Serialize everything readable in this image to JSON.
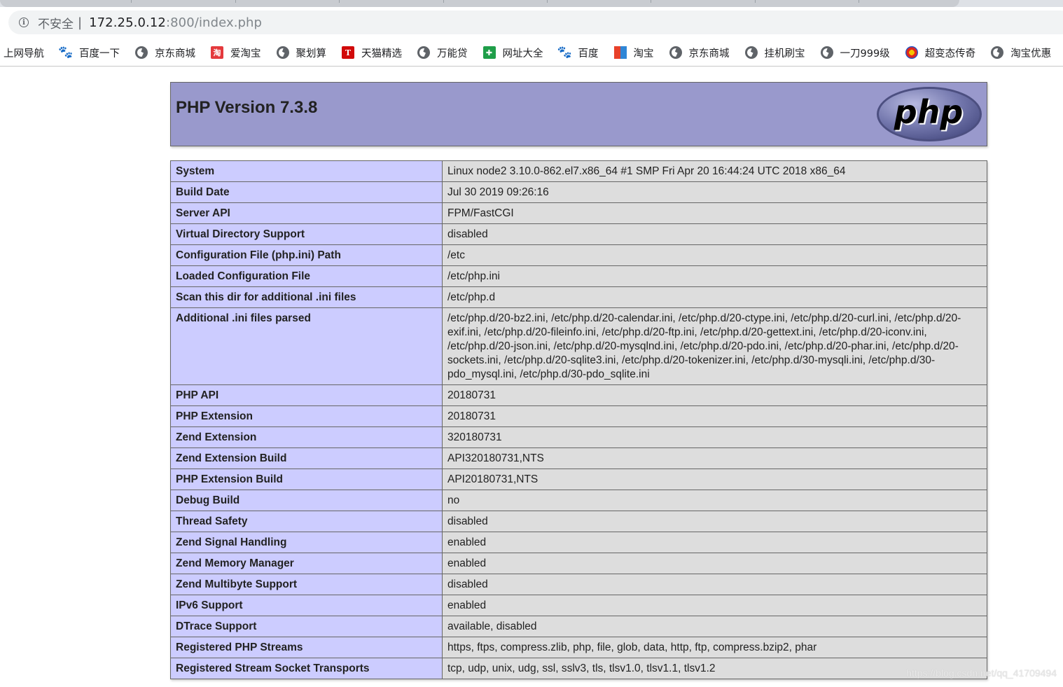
{
  "browser": {
    "insecure_label": "不安全",
    "divider": "|",
    "url_host": "172.25.0.12",
    "url_rest": ":800/index.php"
  },
  "bookmarks": [
    {
      "label": "上网导航",
      "icon": "none"
    },
    {
      "label": "百度一下",
      "icon": "baidu-paw"
    },
    {
      "label": "京东商城",
      "icon": "globe"
    },
    {
      "label": "爱淘宝",
      "icon": "taobao-tao"
    },
    {
      "label": "聚划算",
      "icon": "globe"
    },
    {
      "label": "天猫精选",
      "icon": "tmall-t"
    },
    {
      "label": "万能贷",
      "icon": "globe"
    },
    {
      "label": "网址大全",
      "icon": "wangzhi"
    },
    {
      "label": "百度",
      "icon": "baidu-paw"
    },
    {
      "label": "淘宝",
      "icon": "taobao-grid"
    },
    {
      "label": "京东商城",
      "icon": "globe"
    },
    {
      "label": "挂机刷宝",
      "icon": "globe"
    },
    {
      "label": "一刀999级",
      "icon": "globe"
    },
    {
      "label": "超变态传奇",
      "icon": "chaobian"
    },
    {
      "label": "淘宝优惠",
      "icon": "globe"
    }
  ],
  "php": {
    "title": "PHP Version 7.3.8",
    "logo_text": "php",
    "rows": [
      {
        "key": "System",
        "value": "Linux node2 3.10.0-862.el7.x86_64 #1 SMP Fri Apr 20 16:44:24 UTC 2018 x86_64"
      },
      {
        "key": "Build Date",
        "value": "Jul 30 2019 09:26:16"
      },
      {
        "key": "Server API",
        "value": "FPM/FastCGI"
      },
      {
        "key": "Virtual Directory Support",
        "value": "disabled"
      },
      {
        "key": "Configuration File (php.ini) Path",
        "value": "/etc"
      },
      {
        "key": "Loaded Configuration File",
        "value": "/etc/php.ini"
      },
      {
        "key": "Scan this dir for additional .ini files",
        "value": "/etc/php.d"
      },
      {
        "key": "Additional .ini files parsed",
        "value": "/etc/php.d/20-bz2.ini, /etc/php.d/20-calendar.ini, /etc/php.d/20-ctype.ini, /etc/php.d/20-curl.ini, /etc/php.d/20-exif.ini, /etc/php.d/20-fileinfo.ini, /etc/php.d/20-ftp.ini, /etc/php.d/20-gettext.ini, /etc/php.d/20-iconv.ini, /etc/php.d/20-json.ini, /etc/php.d/20-mysqlnd.ini, /etc/php.d/20-pdo.ini, /etc/php.d/20-phar.ini, /etc/php.d/20-sockets.ini, /etc/php.d/20-sqlite3.ini, /etc/php.d/20-tokenizer.ini, /etc/php.d/30-mysqli.ini, /etc/php.d/30-pdo_mysql.ini, /etc/php.d/30-pdo_sqlite.ini"
      },
      {
        "key": "PHP API",
        "value": "20180731"
      },
      {
        "key": "PHP Extension",
        "value": "20180731"
      },
      {
        "key": "Zend Extension",
        "value": "320180731"
      },
      {
        "key": "Zend Extension Build",
        "value": "API320180731,NTS"
      },
      {
        "key": "PHP Extension Build",
        "value": "API20180731,NTS"
      },
      {
        "key": "Debug Build",
        "value": "no"
      },
      {
        "key": "Thread Safety",
        "value": "disabled"
      },
      {
        "key": "Zend Signal Handling",
        "value": "enabled"
      },
      {
        "key": "Zend Memory Manager",
        "value": "enabled"
      },
      {
        "key": "Zend Multibyte Support",
        "value": "disabled"
      },
      {
        "key": "IPv6 Support",
        "value": "enabled"
      },
      {
        "key": "DTrace Support",
        "value": "available, disabled"
      },
      {
        "key": "Registered PHP Streams",
        "value": "https, ftps, compress.zlib, php, file, glob, data, http, ftp, compress.bzip2, phar"
      },
      {
        "key": "Registered Stream Socket Transports",
        "value": "tcp, udp, unix, udg, ssl, sslv3, tls, tlsv1.0, tlsv1.1, tlsv1.2"
      }
    ]
  },
  "watermark": "https://blog.csdn.net/qq_41709494"
}
